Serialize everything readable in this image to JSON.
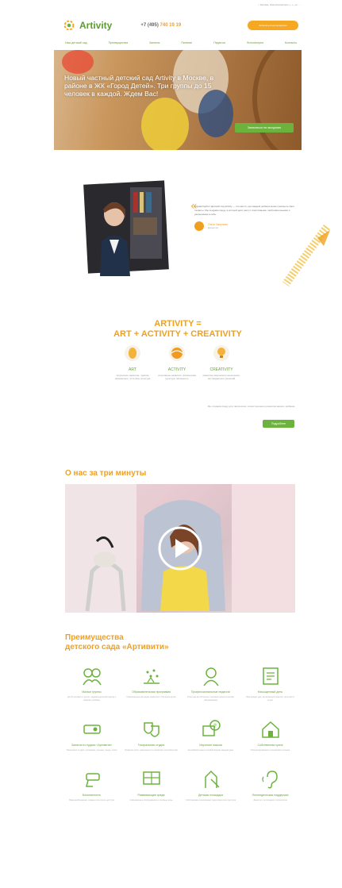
{
  "top_note": "г. Москва, Жилой комплекс «...», ул. ...",
  "logo": {
    "text": "Artivity"
  },
  "header": {
    "phone_prefix": "+7 (495)",
    "phone_number": "740 19 19",
    "cta_label": "Записаться на экскурсию"
  },
  "nav": [
    "Наш детский сад",
    "Преимущества",
    "Занятия",
    "Питание",
    "Педагоги",
    "Фотогалерея",
    "Контакты"
  ],
  "hero": {
    "headline": "Новый частный детский сад Artivity в Москве, в районе в ЖК «Город Детей». Три группы до 15 человек в каждой. Ждем Вас!",
    "cta_label": "Записаться на экскурсию"
  },
  "quote": {
    "text": "Здравствуйте! Детский сад Artivity — это место, где каждый ребёнок может раскрыть свои таланты. Мы создаём среду, в которой дети растут счастливыми, любознательными и уверенными в себе.",
    "author_name": "Ольга Смирнова",
    "author_role": "Директор"
  },
  "brand": {
    "title_line1": "ARTIVITY =",
    "title_line2": "ART + ACTIVITY + CREATIVITY",
    "items": [
      {
        "name": "ART",
        "desc": "творческое развитие, чувство прекрасного, эстетика, культура"
      },
      {
        "name": "ACTIVITY",
        "desc": "спортивное развитие, физическая культура, активность"
      },
      {
        "name": "CREATIVITY",
        "desc": "развитие творческого мышления, нестандартных решений"
      }
    ],
    "note": "Мы создаём среду для творческого и всестороннего развития вашего ребёнка.",
    "more_label": "Подробнее"
  },
  "video_section": {
    "title": "О нас за три минуты"
  },
  "advantages": {
    "title_line1": "Преимущества",
    "title_line2": "детского сада «Артивити»",
    "items": [
      {
        "icon": "kids-icon",
        "name": "Малые группы",
        "desc": "До 15 человек в группе, индивидуальный подход к каждому ребёнку"
      },
      {
        "icon": "fireworks-icon",
        "name": "Образовательная программа",
        "desc": "Современные методики развития и обучения детей"
      },
      {
        "icon": "teacher-icon",
        "name": "Профессиональные педагоги",
        "desc": "Опытные воспитатели с высшим педагогическим образованием"
      },
      {
        "icon": "planner-icon",
        "name": "Насыщенный день",
        "desc": "Распорядок дня, включающий занятия, прогулки и отдых"
      },
      {
        "icon": "projector-icon",
        "name": "Занятия в студиях «Артивити»",
        "desc": "Творческие студии: рисование, музыка, танцы, театр"
      },
      {
        "icon": "theater-icon",
        "name": "Театральная студия",
        "desc": "Развитие речи, уверенности и актёрских способностей"
      },
      {
        "icon": "english-icon",
        "name": "Изучение языков",
        "desc": "Английский язык в игровой форме каждый день"
      },
      {
        "icon": "house-icon",
        "name": "Собственная кухня",
        "desc": "Сбалансированное пятиразовое питание"
      },
      {
        "icon": "camera-icon",
        "name": "Безопасность",
        "desc": "Видеонаблюдение, охрана и контроль доступа"
      },
      {
        "icon": "chalkboard-icon",
        "name": "Развивающая среда",
        "desc": "Современное оборудование и игровые зоны"
      },
      {
        "icon": "playground-icon",
        "name": "Детская площадка",
        "desc": "Собственная огороженная территория для прогулок"
      },
      {
        "icon": "ear-icon",
        "name": "Логопедическая поддержка",
        "desc": "Занятия с логопедом и психологом"
      }
    ]
  },
  "colors": {
    "accent_orange": "#f0a020",
    "accent_green": "#6cb33e"
  }
}
